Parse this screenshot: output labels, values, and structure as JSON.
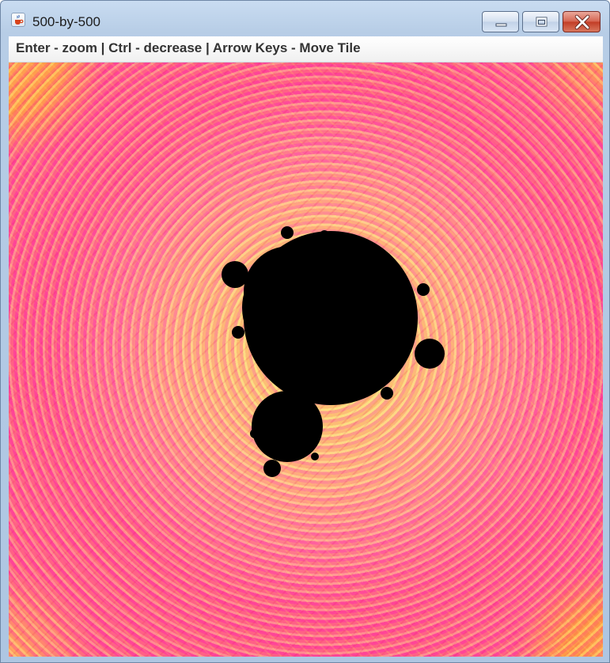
{
  "window": {
    "title": "500-by-500",
    "title_icon": "java-cup-icon",
    "controls": [
      "minimize-icon",
      "maximize-icon",
      "close-icon"
    ],
    "close_color": "#c23c25"
  },
  "hint_bar": {
    "text": "Enter - zoom | Ctrl - decrease | Arrow Keys - Move Tile"
  },
  "canvas": {
    "content": "mandelbrot-fractal",
    "palette": [
      "#ff4aa0",
      "#ff9a4a",
      "#ffd88a",
      "#ffff66",
      "#e0207a",
      "#000000"
    ]
  }
}
